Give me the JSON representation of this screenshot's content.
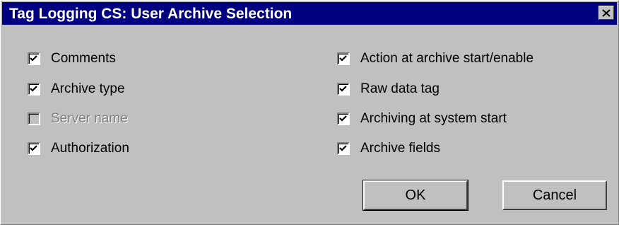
{
  "window": {
    "title": "Tag Logging CS: User Archive Selection",
    "close_icon": "close-icon"
  },
  "options_left": [
    {
      "label": "Comments",
      "checked": true,
      "enabled": true
    },
    {
      "label": "Archive type",
      "checked": true,
      "enabled": true
    },
    {
      "label": "Server name",
      "checked": false,
      "enabled": false
    },
    {
      "label": "Authorization",
      "checked": true,
      "enabled": true
    }
  ],
  "options_right": [
    {
      "label": "Action at archive start/enable",
      "checked": true,
      "enabled": true
    },
    {
      "label": "Raw data tag",
      "checked": true,
      "enabled": true
    },
    {
      "label": "Archiving at system start",
      "checked": true,
      "enabled": true
    },
    {
      "label": "Archive fields",
      "checked": true,
      "enabled": true
    }
  ],
  "buttons": {
    "ok_label": "OK",
    "cancel_label": "Cancel"
  },
  "colors": {
    "titlebar": "#000080",
    "dialog_bg": "#c0c0c0"
  }
}
